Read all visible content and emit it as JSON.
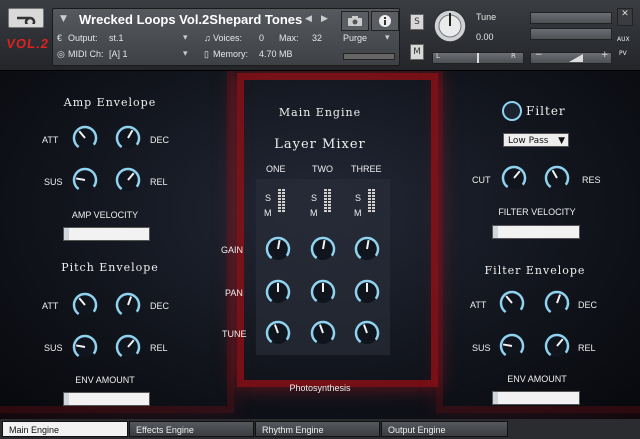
{
  "header": {
    "instrument_name": "Wrecked Loops Vol.2Shepard Tones",
    "output_label": "Output:",
    "output_value": "st.1",
    "voices_label": "Voices:",
    "voices_value": "0",
    "max_label": "Max:",
    "max_value": "32",
    "purge_label": "Purge",
    "midi_label": "MIDI Ch:",
    "midi_value": "[A]  1",
    "memory_label": "Memory:",
    "memory_value": "4.70 MB",
    "logo_text": "VOL.2",
    "tune_label": "Tune",
    "tune_value": "0.00",
    "solo_label": "S",
    "mute_label": "M",
    "pan_left": "L",
    "pan_right": "R",
    "aux_label": "AUX",
    "pv_label": "PV",
    "minus": "−",
    "plus": "+"
  },
  "amp_envelope": {
    "title": "Amp Envelope",
    "att": "ATT",
    "dec": "DEC",
    "sus": "SUS",
    "rel": "REL",
    "velocity_label": "AMP VELOCITY",
    "velocity_value": 0.06
  },
  "pitch_envelope": {
    "title": "Pitch Envelope",
    "att": "ATT",
    "dec": "DEC",
    "sus": "SUS",
    "rel": "REL",
    "amount_label": "ENV AMOUNT",
    "amount_value": 0.06
  },
  "main_engine": {
    "title": "Main Engine",
    "mixer_title": "Layer Mixer",
    "columns": [
      "ONE",
      "TWO",
      "THREE"
    ],
    "rows": [
      "GAIN",
      "PAN",
      "TUNE"
    ],
    "s": "S",
    "m": "M",
    "preset_name": "Photosynthesis"
  },
  "filter": {
    "title": "Filter",
    "type": "Low Pass",
    "cut": "CUT",
    "res": "RES",
    "velocity_label": "FILTER VELOCITY",
    "velocity_value": 0.06
  },
  "filter_envelope": {
    "title": "Filter Envelope",
    "att": "ATT",
    "dec": "DEC",
    "sus": "SUS",
    "rel": "REL",
    "amount_label": "ENV AMOUNT",
    "amount_value": 0.06
  },
  "tabs": [
    {
      "label": "Main Engine",
      "active": true
    },
    {
      "label": "Effects Engine",
      "active": false
    },
    {
      "label": "Rhythm Engine",
      "active": false
    },
    {
      "label": "Output Engine",
      "active": false
    }
  ],
  "colors": {
    "accent": "#8fd3f0",
    "frame_red": "#960f14"
  }
}
